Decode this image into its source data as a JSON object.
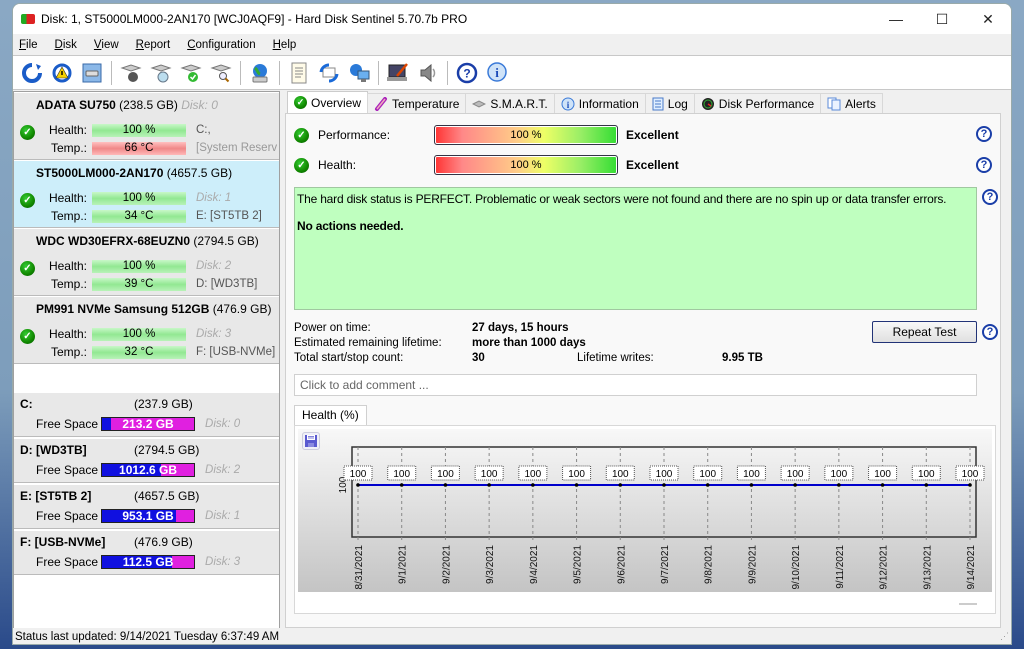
{
  "window": {
    "title": "Disk: 1, ST5000LM000-2AN170 [WCJ0AQF9]  -  Hard Disk Sentinel 5.70.7b PRO",
    "controls": {
      "minimize": "—",
      "maximize": "☐",
      "close": "✕"
    }
  },
  "menu": [
    "File",
    "Disk",
    "View",
    "Report",
    "Configuration",
    "Help"
  ],
  "toolbar": {
    "icons": [
      "refresh-icon",
      "alert-refresh-icon",
      "disk-icon",
      "disk-surface-test-icon",
      "disk-short-test-icon",
      "disk-ok-test-icon",
      "disk-search-icon",
      "network-disk-icon",
      "report-icon",
      "send-report-icon",
      "network-icon",
      "settings-icon",
      "sound-icon",
      "help-icon",
      "info-icon"
    ]
  },
  "disks": [
    {
      "name": "ADATA SU750",
      "size": "(238.5 GB)",
      "disk_label": "Disk: 0",
      "health_label": "Health:",
      "health": "100 %",
      "health_pct": 100,
      "temp_label": "Temp.:",
      "temp": "66 °C",
      "temp_status": "hot",
      "aux1": "C:,",
      "aux2": "[System Reserv",
      "selected": false
    },
    {
      "name": "ST5000LM000-2AN170",
      "size": "(4657.5 GB)",
      "disk_label": "",
      "health_label": "Health:",
      "health": "100 %",
      "health_pct": 100,
      "temp_label": "Temp.:",
      "temp": "34 °C",
      "temp_status": "ok",
      "aux1": "Disk: 1",
      "aux2": "E: [ST5TB 2]",
      "selected": true
    },
    {
      "name": "WDC WD30EFRX-68EUZN0",
      "size": "(2794.5 GB)",
      "disk_label": "",
      "health_label": "Health:",
      "health": "100 %",
      "health_pct": 100,
      "temp_label": "Temp.:",
      "temp": "39 °C",
      "temp_status": "ok",
      "aux1": "Disk: 2",
      "aux2": "D: [WD3TB]",
      "selected": false
    },
    {
      "name": "PM991 NVMe Samsung 512GB",
      "size": "(476.9 GB)",
      "disk_label": "",
      "health_label": "Health:",
      "health": "100 %",
      "health_pct": 100,
      "temp_label": "Temp.:",
      "temp": "32 °C",
      "temp_status": "ok",
      "aux1": "Disk: 3",
      "aux2": "F: [USB-NVMe]",
      "selected": false
    }
  ],
  "volumes": [
    {
      "name": "C:",
      "size": "(237.9 GB)",
      "free_label": "Free Space",
      "free": "213.2 GB",
      "used_fraction": 0.1,
      "disk": "Disk: 0"
    },
    {
      "name": "D: [WD3TB]",
      "size": "(2794.5 GB)",
      "free_label": "Free Space",
      "free": "1012.6 GB",
      "used_fraction": 0.64,
      "disk": "Disk: 2"
    },
    {
      "name": "E: [ST5TB 2]",
      "size": "(4657.5 GB)",
      "free_label": "Free Space",
      "free": "953.1 GB",
      "used_fraction": 0.8,
      "disk": "Disk: 1"
    },
    {
      "name": "F: [USB-NVMe]",
      "size": "(476.9 GB)",
      "free_label": "Free Space",
      "free": "112.5 GB",
      "used_fraction": 0.76,
      "disk": "Disk: 3"
    }
  ],
  "status_bar": "Status last updated: 9/14/2021 Tuesday 6:37:49 AM",
  "tabs": [
    {
      "label": "Overview",
      "icon": "check-icon",
      "active": true
    },
    {
      "label": "Temperature",
      "icon": "thermometer-icon",
      "active": false
    },
    {
      "label": "S.M.A.R.T.",
      "icon": "smart-icon",
      "active": false
    },
    {
      "label": "Information",
      "icon": "info-icon",
      "active": false
    },
    {
      "label": "Log",
      "icon": "log-icon",
      "active": false
    },
    {
      "label": "Disk Performance",
      "icon": "gauge-icon",
      "active": false
    },
    {
      "label": "Alerts",
      "icon": "alerts-icon",
      "active": false
    }
  ],
  "overview": {
    "performance": {
      "label": "Performance:",
      "value": "100 %",
      "pct": 100,
      "rating": "Excellent"
    },
    "health": {
      "label": "Health:",
      "value": "100 %",
      "pct": 100,
      "rating": "Excellent"
    },
    "status_text": "The hard disk status is PERFECT. Problematic or weak sectors were not found and there are no spin up or data transfer errors.",
    "action_text": "No actions needed.",
    "power_on_label": "Power on time:",
    "power_on_value": "27 days, 15 hours",
    "lifetime_label": "Estimated remaining lifetime:",
    "lifetime_value": "more than 1000 days",
    "startstop_label": "Total start/stop count:",
    "startstop_value": "30",
    "writes_label": "Lifetime writes:",
    "writes_value": "9.95 TB",
    "repeat_button": "Repeat Test",
    "comment_placeholder": "Click to add comment ...",
    "chart_tab": "Health (%)"
  },
  "chart_data": {
    "type": "line",
    "title": "Health (%)",
    "xlabel": "",
    "ylabel": "",
    "x": [
      "8/31/2021",
      "9/1/2021",
      "9/2/2021",
      "9/3/2021",
      "9/4/2021",
      "9/5/2021",
      "9/6/2021",
      "9/7/2021",
      "9/8/2021",
      "9/9/2021",
      "9/10/2021",
      "9/11/2021",
      "9/12/2021",
      "9/13/2021",
      "9/14/2021"
    ],
    "series": [
      {
        "name": "Health",
        "values": [
          100,
          100,
          100,
          100,
          100,
          100,
          100,
          100,
          100,
          100,
          100,
          100,
          100,
          100,
          100
        ],
        "color": "#0000cc"
      }
    ],
    "y_ticks": [
      "100"
    ],
    "data_labels": true,
    "grid": true
  }
}
